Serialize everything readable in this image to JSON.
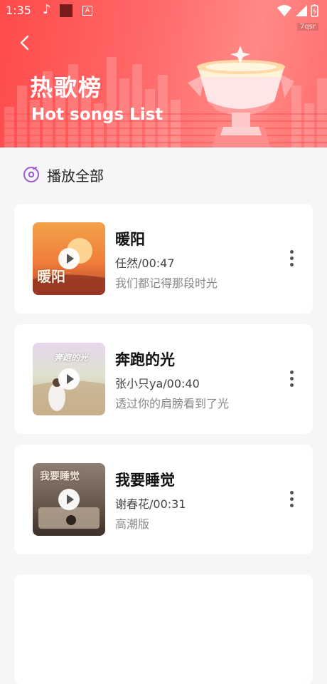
{
  "status_bar": {
    "time": "1:35"
  },
  "watermark": "7qsr",
  "header": {
    "title_cn": "热歌榜",
    "title_en": "Hot songs List"
  },
  "play_all": {
    "label": "播放全部"
  },
  "songs": [
    {
      "title": "暖阳",
      "artist_duration": "任然/00:47",
      "description": "我们都记得那段时光",
      "cover_text": "暖阳"
    },
    {
      "title": "奔跑的光",
      "artist_duration": "张小只ya/00:40",
      "description": "透过你的肩膀看到了光",
      "cover_text": "奔跑的光"
    },
    {
      "title": "我要睡觉",
      "artist_duration": "谢春花/00:31",
      "description": "高潮版",
      "cover_text": "我要睡觉"
    }
  ],
  "colors": {
    "banner_start": "#ff4a4a",
    "banner_end": "#ff8a86",
    "play_all_icon": "#9b59d6",
    "background": "#f6f6f8"
  }
}
